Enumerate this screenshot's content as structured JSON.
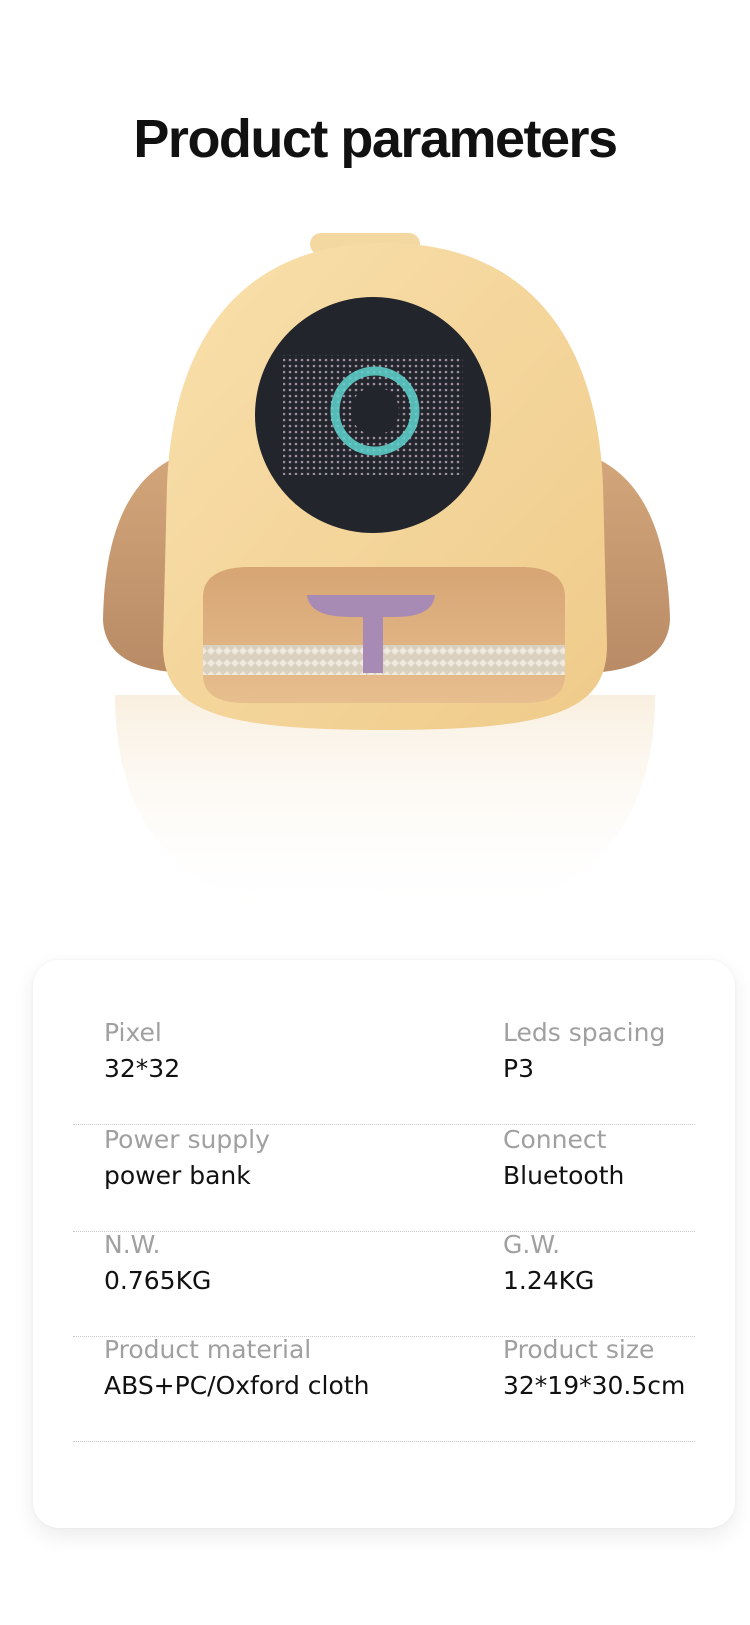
{
  "page": {
    "title": "Product parameters"
  },
  "product_image": {
    "subject": "backpack-with-led-pixel-screen",
    "body_color": "#F6D9A0",
    "flap_color": "#C4936A",
    "screen_color": "#22252B"
  },
  "specs": [
    {
      "left_label": "Pixel",
      "left_value": "32*32",
      "right_label": "Leds spacing",
      "right_value": "P3"
    },
    {
      "left_label": "Power supply",
      "left_value": "power bank",
      "right_label": "Connect",
      "right_value": "Bluetooth"
    },
    {
      "left_label": "N.W.",
      "left_value": "0.765KG",
      "right_label": "G.W.",
      "right_value": "1.24KG"
    },
    {
      "left_label": "Product material",
      "left_value": "ABS+PC/Oxford cloth",
      "right_label": "Product size",
      "right_value": "32*19*30.5cm"
    }
  ]
}
